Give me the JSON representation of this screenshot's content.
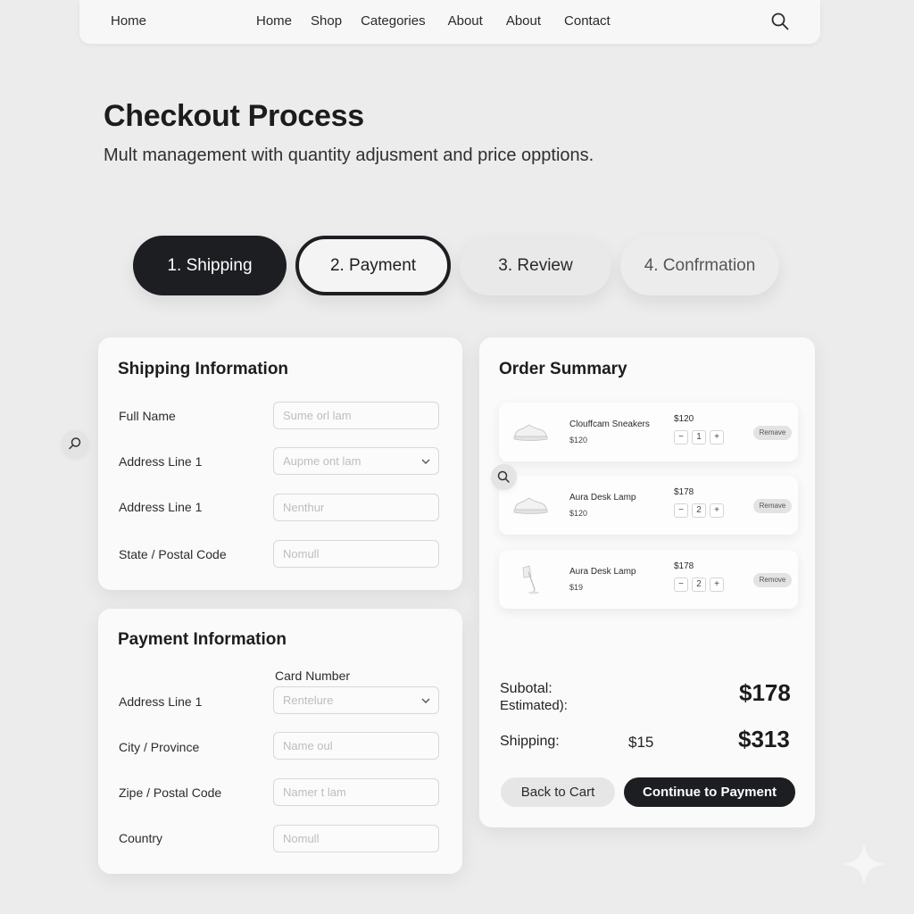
{
  "nav": {
    "home": "Home",
    "links": [
      "Home",
      "Shop",
      "Categories",
      "About",
      "About",
      "Contact"
    ],
    "search_icon": "search-icon"
  },
  "header": {
    "title": "Checkout Process",
    "subtitle": "Mult management with quantity adjusment and price opptions."
  },
  "steps": [
    {
      "label": "1. Shipping",
      "state": "active"
    },
    {
      "label": "2. Payment",
      "state": "outlined"
    },
    {
      "label": "3. Review",
      "state": "inactive"
    },
    {
      "label": "4. Confrmation",
      "state": "inactive"
    }
  ],
  "shipping": {
    "title": "Shipping Information",
    "fields": [
      {
        "label": "Full Name",
        "placeholder": "Sume orl lam"
      },
      {
        "label": "Address Line 1",
        "placeholder": "Aupme ont lam"
      },
      {
        "label": "Address Line 1",
        "placeholder": "Nenthur"
      },
      {
        "label": "State / Postal Code",
        "placeholder": "Nomull"
      }
    ]
  },
  "payment": {
    "title": "Payment Information",
    "card_number_label": "Card Number",
    "fields": [
      {
        "label": "Address Line 1",
        "placeholder": "Rentelure"
      },
      {
        "label": "City / Province",
        "placeholder": "Name oul"
      },
      {
        "label": "Zipe / Postal Code",
        "placeholder": "Namer t lam"
      },
      {
        "label": "Country",
        "placeholder": "Nomull"
      }
    ]
  },
  "summary": {
    "title": "Order Summary",
    "items": [
      {
        "name": "Clouffcam Sneakers",
        "sub_price": "$120",
        "price": "$120",
        "qty": "1",
        "remove": "Remave",
        "image": "sneaker-icon"
      },
      {
        "name": "Aura Desk Lamp",
        "sub_price": "$120",
        "price": "$178",
        "qty": "2",
        "remove": "Remave",
        "image": "sneaker-icon"
      },
      {
        "name": "Aura Desk Lamp",
        "sub_price": "$19",
        "price": "$178",
        "qty": "2",
        "remove": "Remove",
        "image": "lamp-icon"
      }
    ],
    "qty_minus": "−",
    "qty_plus": "+",
    "subtotal_label": "Subotal:",
    "estimated_label": "Estimated):",
    "subtotal_value": "$178",
    "shipping_label": "Shipping:",
    "shipping_value": "$15",
    "total_value": "$313",
    "back_button": "Back to Cart",
    "continue_button": "Continue to Payment"
  },
  "colors": {
    "background": "#ececec",
    "card": "#fafafa",
    "primary_dark": "#1d1e22"
  }
}
